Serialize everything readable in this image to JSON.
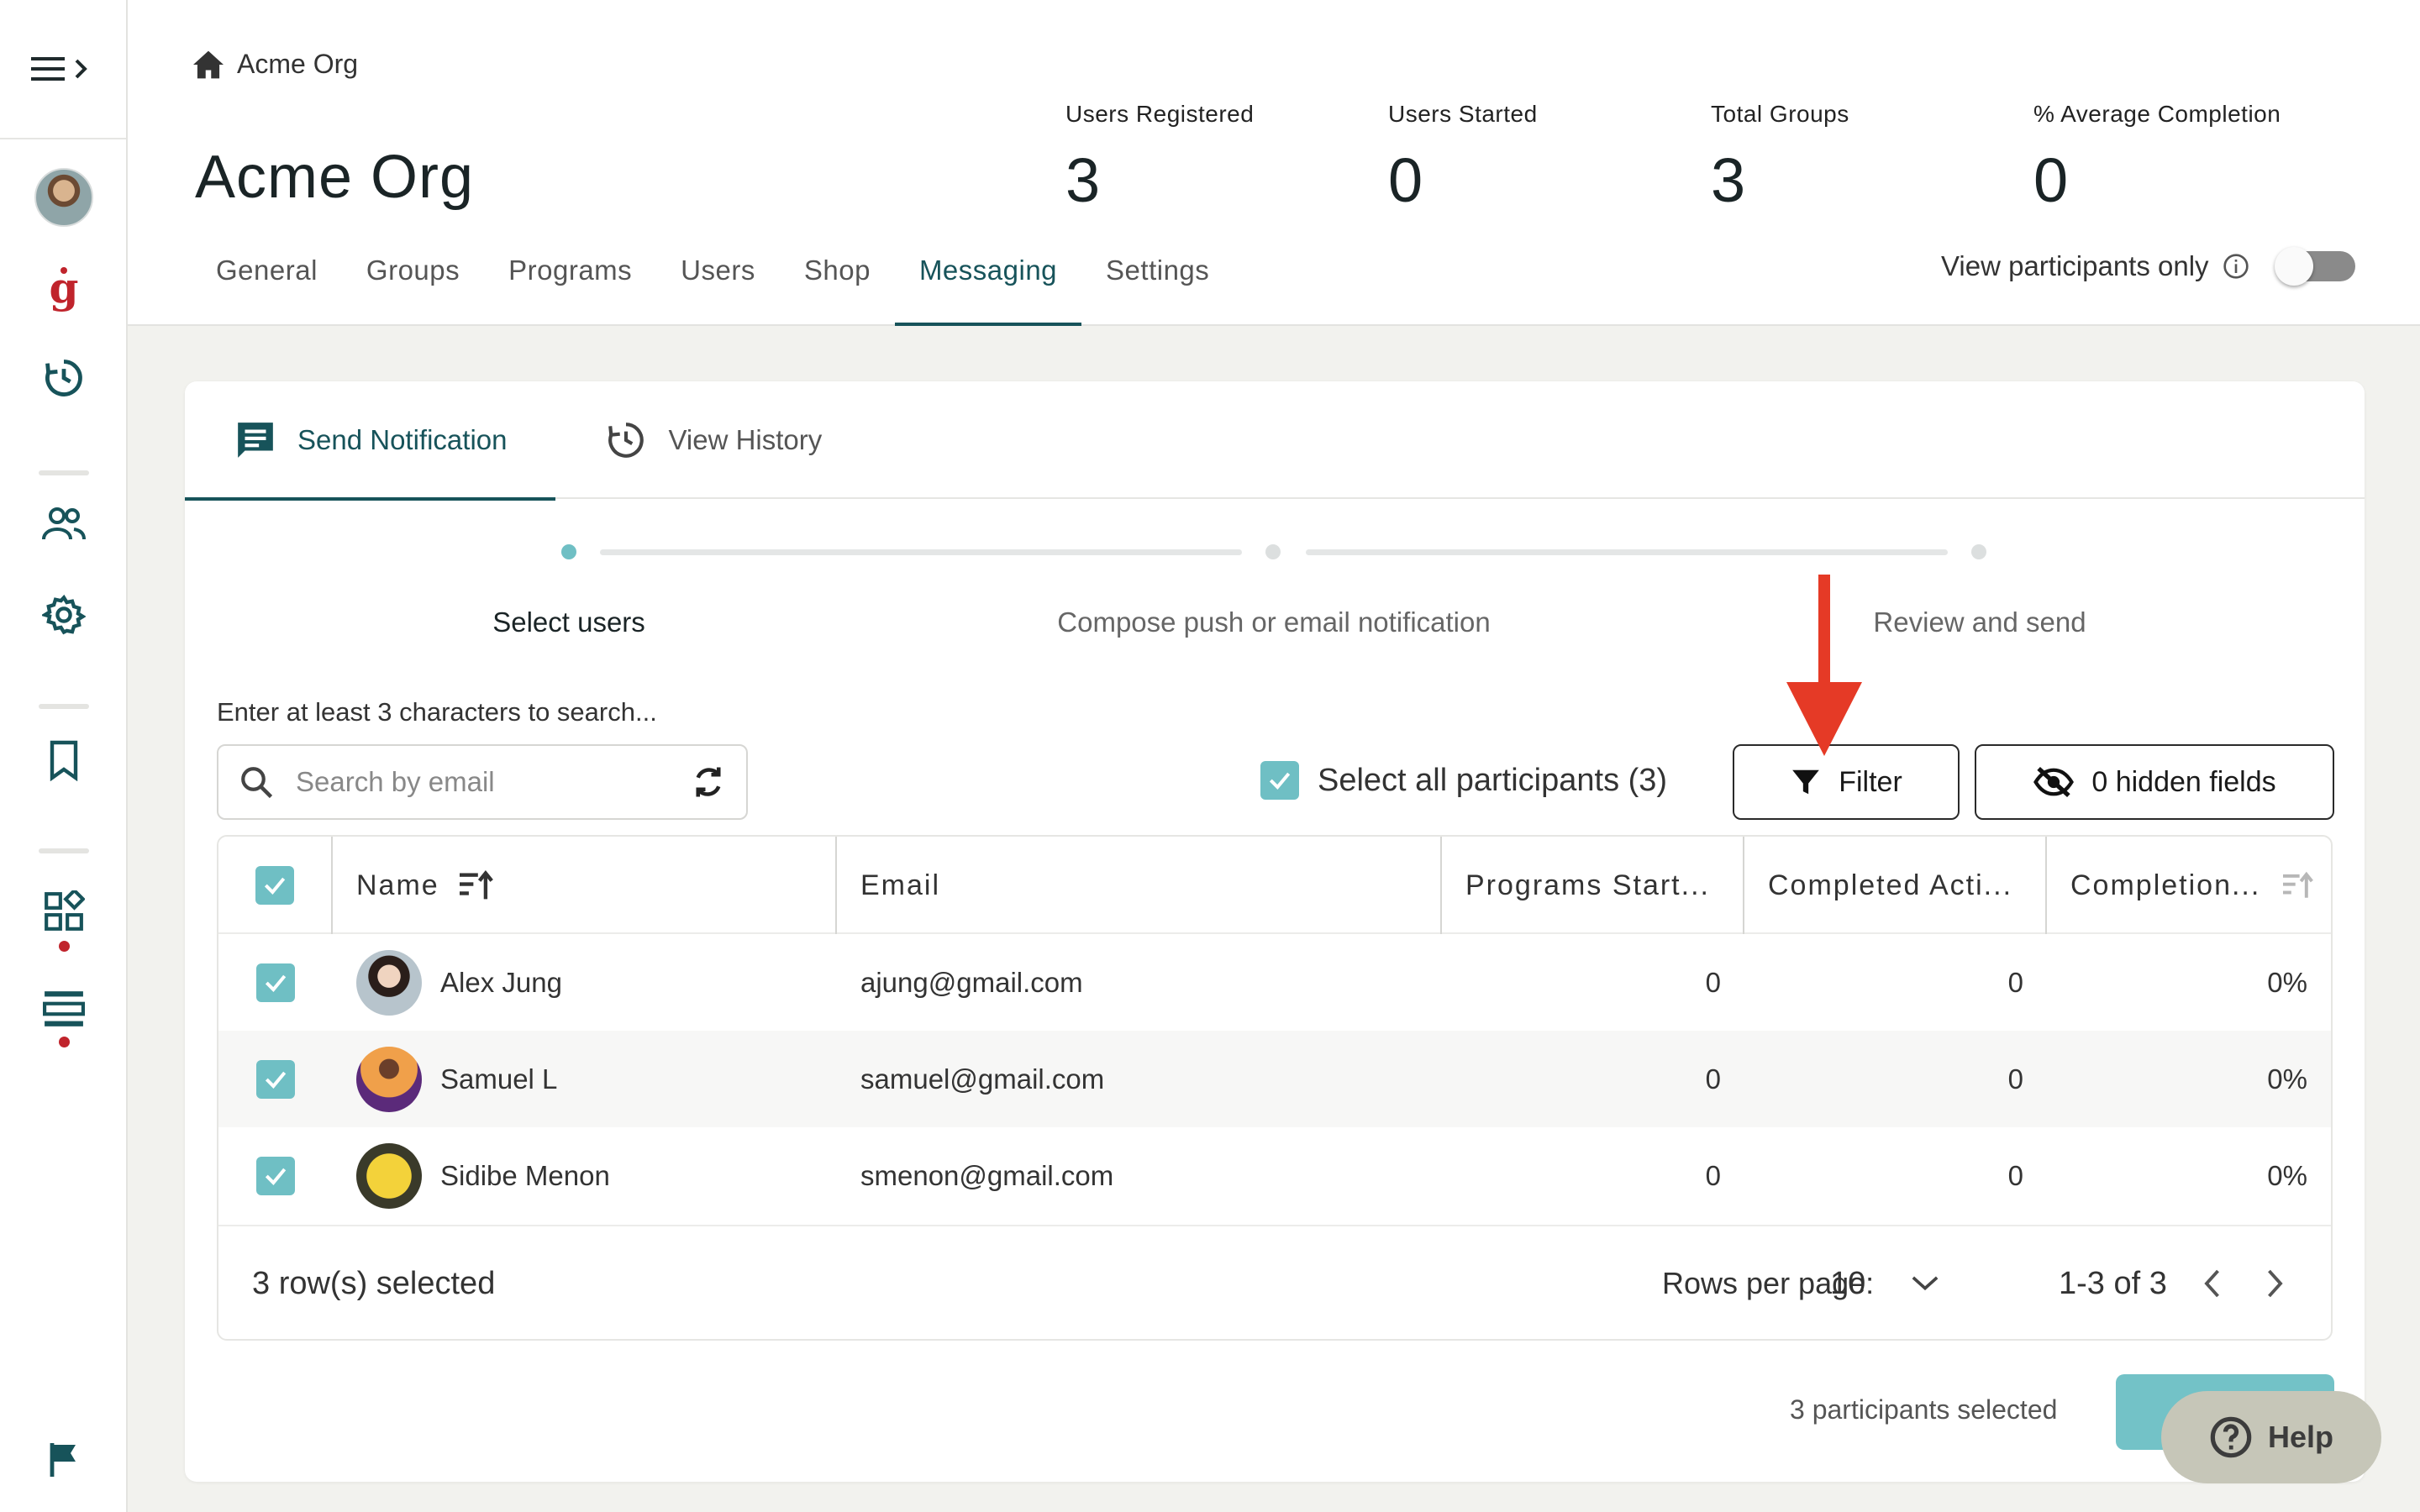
{
  "breadcrumb": {
    "label": "Acme Org"
  },
  "org": {
    "title": "Acme Org"
  },
  "stats": [
    {
      "label": "Users Registered",
      "value": "3"
    },
    {
      "label": "Users Started",
      "value": "0"
    },
    {
      "label": "Total Groups",
      "value": "3"
    },
    {
      "label": "% Average Completion",
      "value": "0"
    }
  ],
  "tabs": [
    {
      "label": "General"
    },
    {
      "label": "Groups"
    },
    {
      "label": "Programs"
    },
    {
      "label": "Users"
    },
    {
      "label": "Shop"
    },
    {
      "label": "Messaging",
      "active": true
    },
    {
      "label": "Settings"
    }
  ],
  "view_participants": {
    "label": "View participants only",
    "enabled": false
  },
  "subtabs": [
    {
      "label": "Send Notification",
      "active": true
    },
    {
      "label": "View History"
    }
  ],
  "steps": [
    {
      "label": "Select users",
      "active": true
    },
    {
      "label": "Compose push or email notification"
    },
    {
      "label": "Review and send"
    }
  ],
  "search": {
    "hint": "Enter at least 3 characters to search...",
    "placeholder": "Search by email"
  },
  "select_all": {
    "label": "Select all participants (3)"
  },
  "filter_button": {
    "label": "Filter"
  },
  "hidden_fields_button": {
    "label": "0 hidden fields"
  },
  "table": {
    "columns": [
      "Name",
      "Email",
      "Programs Start...",
      "Completed Acti...",
      "Completion..."
    ],
    "rows": [
      {
        "name": "Alex Jung",
        "email": "ajung@gmail.com",
        "programs_started": "0",
        "completed_activities": "0",
        "completion": "0%"
      },
      {
        "name": "Samuel L",
        "email": "samuel@gmail.com",
        "programs_started": "0",
        "completed_activities": "0",
        "completion": "0%"
      },
      {
        "name": "Sidibe Menon",
        "email": "smenon@gmail.com",
        "programs_started": "0",
        "completed_activities": "0",
        "completion": "0%"
      }
    ],
    "footer": {
      "selected": "3 row(s) selected",
      "rows_per_page_label": "Rows per page:",
      "rows_per_page_value": "10",
      "range": "1-3 of 3"
    }
  },
  "participants_selected": "3 participants selected",
  "help": {
    "label": "Help"
  },
  "colors": {
    "accent": "#17535a",
    "checkbox": "#6fbfc4",
    "brand_red": "#c0242c",
    "annotation_arrow": "#e53a26"
  }
}
